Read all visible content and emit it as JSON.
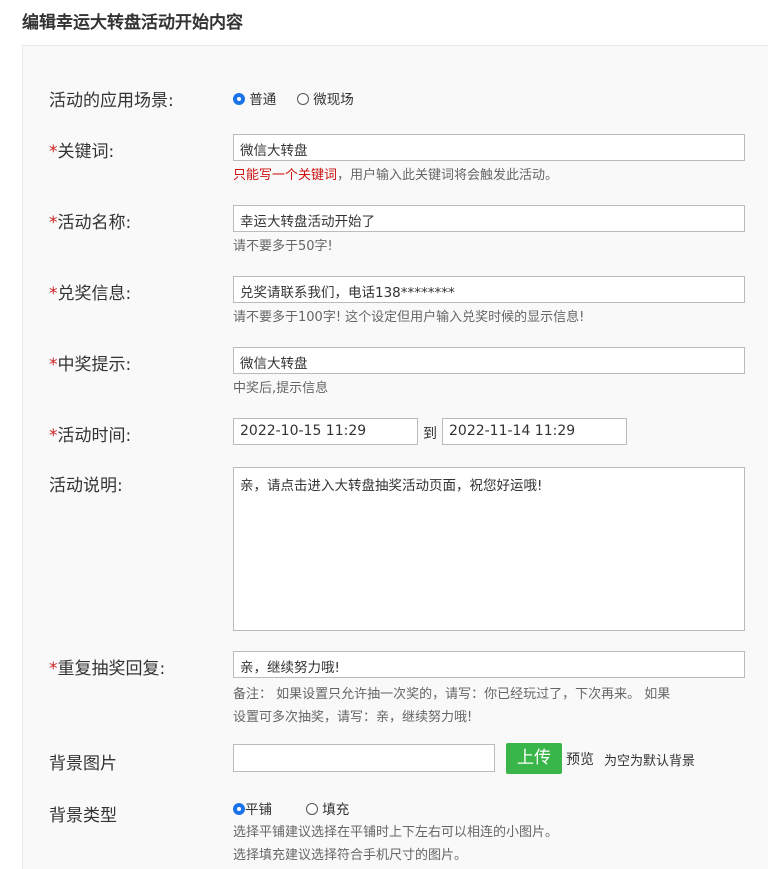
{
  "page": {
    "title": "编辑幸运大转盘活动开始内容"
  },
  "scene": {
    "label": "活动的应用场景:",
    "options": [
      "普通",
      "微现场"
    ],
    "selected": "普通"
  },
  "keyword": {
    "required_mark": "*",
    "label": "关键词:",
    "value": "微信大转盘",
    "hint_red": "只能写一个关键词",
    "hint_rest": "，用户输入此关键词将会触发此活动。"
  },
  "activity_name": {
    "required_mark": "*",
    "label": "活动名称:",
    "value": "幸运大转盘活动开始了",
    "hint": "请不要多于50字!"
  },
  "prize_info": {
    "required_mark": "*",
    "label": "兑奖信息:",
    "value": "兑奖请联系我们，电话138********",
    "hint": "请不要多于100字! 这个设定但用户输入兑奖时候的显示信息!"
  },
  "win_tip": {
    "required_mark": "*",
    "label": "中奖提示:",
    "value": "微信大转盘",
    "hint": "中奖后,提示信息"
  },
  "activity_time": {
    "required_mark": "*",
    "label": "活动时间:",
    "start": "2022-10-15 11:29",
    "separator": "到",
    "end": "2022-11-14 11:29"
  },
  "description": {
    "label": "活动说明:",
    "value": "亲，请点击进入大转盘抽奖活动页面，祝您好运哦!"
  },
  "repeat_reply": {
    "required_mark": "*",
    "label": "重复抽奖回复:",
    "value": "亲，继续努力哦!",
    "hint_line1": "备注： 如果设置只允许抽一次奖的，请写：你已经玩过了，下次再来。 如果",
    "hint_line2": "设置可多次抽奖，请写：亲，继续努力哦!"
  },
  "bg_image": {
    "label": "背景图片",
    "value": "",
    "upload_label": "上传",
    "preview_label": "预览",
    "note": "为空为默认背景"
  },
  "bg_type": {
    "label": "背景类型",
    "options": [
      "平铺",
      "填充"
    ],
    "selected": "平铺",
    "hint_line1": "选择平铺建议选择在平铺时上下左右可以相连的小图片。",
    "hint_line2": "选择填充建议选择符合手机尺寸的图片。"
  },
  "colors": {
    "required": "#cc2222",
    "upload_button": "#3ab54a",
    "radio_selected": "#1a73e8"
  }
}
